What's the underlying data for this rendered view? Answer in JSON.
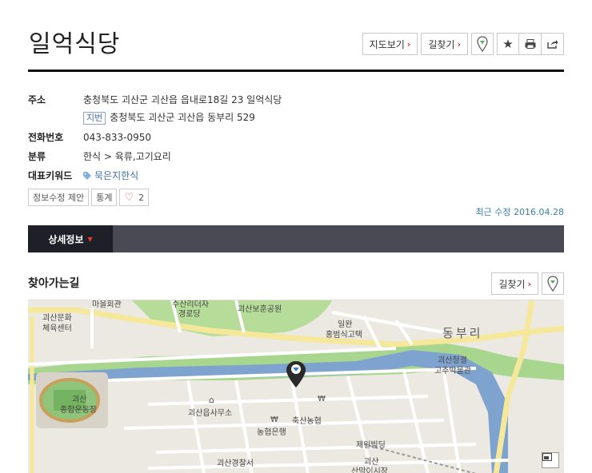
{
  "header": {
    "title": "일억식당",
    "map_view_label": "지도보기",
    "directions_label": "길찾기"
  },
  "info": {
    "address_label": "주소",
    "address": "충청북도 괴산군 괴산읍 읍내로18길 23 일억식당",
    "jibun_label": "지번",
    "jibun_address": "충청북도 괴산군 괴산읍 동부리 529",
    "phone_label": "전화번호",
    "phone": "043-833-0950",
    "category_label": "분류",
    "category": "한식 > 육류,고기요리",
    "keyword_label": "대표키워드",
    "keyword": "묵은지한식"
  },
  "actions": {
    "edit_label": "정보수정 제안",
    "stats_label": "통계",
    "like_count": "2"
  },
  "updated": "최근 수정 2016.04.28",
  "tabs": {
    "detail_label": "상세정보"
  },
  "directions_section": {
    "title": "찾아가는길",
    "directions_label": "길찾기"
  },
  "map": {
    "labels": {
      "l1": "마을회관",
      "l2a": "수산리더자",
      "l2b": "경로당",
      "l3": "괴산보훈공원",
      "l4a": "괴산문화",
      "l4b": "체육센터",
      "l5a": "일완",
      "l5b": "홍범식고택",
      "l6": "동부리",
      "l7a": "괴산청결",
      "l7b": "고추박물관",
      "l8a": "괴산",
      "l8b": "종합운동장",
      "l9": "괴산읍사무소",
      "l10": "축산농협",
      "l11": "농협은행",
      "l12": "제일빌딩",
      "l13": "괴산경찰서",
      "l14a": "괴산",
      "l14b": "산막이시장"
    }
  },
  "colors": {
    "accent": "#d32f2f",
    "tab_bg": "#4a4a55",
    "tab_active": "#1f1f27",
    "link": "#3a6ea5",
    "river": "#7fa3cf",
    "green": "#9fcf85"
  }
}
